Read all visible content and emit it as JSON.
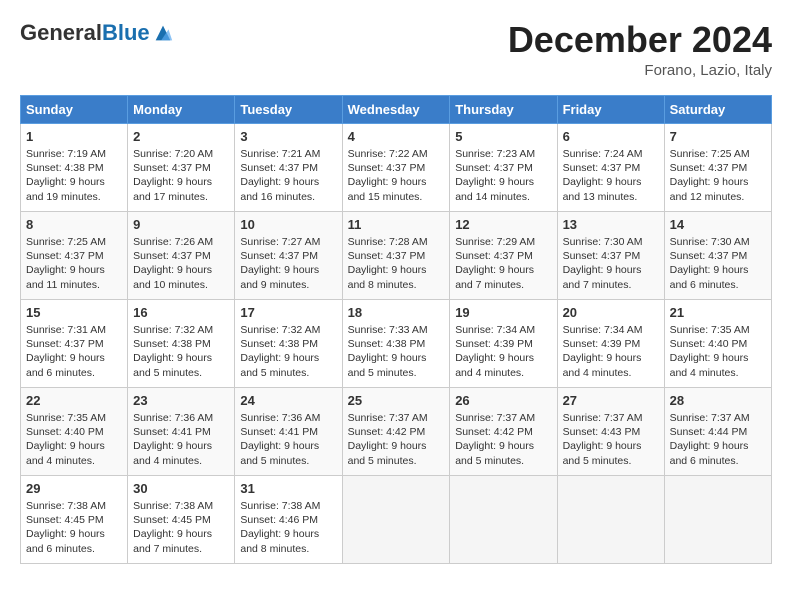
{
  "header": {
    "logo_general": "General",
    "logo_blue": "Blue",
    "month_title": "December 2024",
    "subtitle": "Forano, Lazio, Italy"
  },
  "weekdays": [
    "Sunday",
    "Monday",
    "Tuesday",
    "Wednesday",
    "Thursday",
    "Friday",
    "Saturday"
  ],
  "weeks": [
    [
      {
        "day": "1",
        "sunrise": "7:19 AM",
        "sunset": "4:38 PM",
        "daylight_h": "9",
        "daylight_m": "19"
      },
      {
        "day": "2",
        "sunrise": "7:20 AM",
        "sunset": "4:37 PM",
        "daylight_h": "9",
        "daylight_m": "17"
      },
      {
        "day": "3",
        "sunrise": "7:21 AM",
        "sunset": "4:37 PM",
        "daylight_h": "9",
        "daylight_m": "16"
      },
      {
        "day": "4",
        "sunrise": "7:22 AM",
        "sunset": "4:37 PM",
        "daylight_h": "9",
        "daylight_m": "15"
      },
      {
        "day": "5",
        "sunrise": "7:23 AM",
        "sunset": "4:37 PM",
        "daylight_h": "9",
        "daylight_m": "14"
      },
      {
        "day": "6",
        "sunrise": "7:24 AM",
        "sunset": "4:37 PM",
        "daylight_h": "9",
        "daylight_m": "13"
      },
      {
        "day": "7",
        "sunrise": "7:25 AM",
        "sunset": "4:37 PM",
        "daylight_h": "9",
        "daylight_m": "12"
      }
    ],
    [
      {
        "day": "8",
        "sunrise": "7:25 AM",
        "sunset": "4:37 PM",
        "daylight_h": "9",
        "daylight_m": "11"
      },
      {
        "day": "9",
        "sunrise": "7:26 AM",
        "sunset": "4:37 PM",
        "daylight_h": "9",
        "daylight_m": "10"
      },
      {
        "day": "10",
        "sunrise": "7:27 AM",
        "sunset": "4:37 PM",
        "daylight_h": "9",
        "daylight_m": "9"
      },
      {
        "day": "11",
        "sunrise": "7:28 AM",
        "sunset": "4:37 PM",
        "daylight_h": "9",
        "daylight_m": "8"
      },
      {
        "day": "12",
        "sunrise": "7:29 AM",
        "sunset": "4:37 PM",
        "daylight_h": "9",
        "daylight_m": "7"
      },
      {
        "day": "13",
        "sunrise": "7:30 AM",
        "sunset": "4:37 PM",
        "daylight_h": "9",
        "daylight_m": "7"
      },
      {
        "day": "14",
        "sunrise": "7:30 AM",
        "sunset": "4:37 PM",
        "daylight_h": "9",
        "daylight_m": "6"
      }
    ],
    [
      {
        "day": "15",
        "sunrise": "7:31 AM",
        "sunset": "4:37 PM",
        "daylight_h": "9",
        "daylight_m": "6"
      },
      {
        "day": "16",
        "sunrise": "7:32 AM",
        "sunset": "4:38 PM",
        "daylight_h": "9",
        "daylight_m": "5"
      },
      {
        "day": "17",
        "sunrise": "7:32 AM",
        "sunset": "4:38 PM",
        "daylight_h": "9",
        "daylight_m": "5"
      },
      {
        "day": "18",
        "sunrise": "7:33 AM",
        "sunset": "4:38 PM",
        "daylight_h": "9",
        "daylight_m": "5"
      },
      {
        "day": "19",
        "sunrise": "7:34 AM",
        "sunset": "4:39 PM",
        "daylight_h": "9",
        "daylight_m": "4"
      },
      {
        "day": "20",
        "sunrise": "7:34 AM",
        "sunset": "4:39 PM",
        "daylight_h": "9",
        "daylight_m": "4"
      },
      {
        "day": "21",
        "sunrise": "7:35 AM",
        "sunset": "4:40 PM",
        "daylight_h": "9",
        "daylight_m": "4"
      }
    ],
    [
      {
        "day": "22",
        "sunrise": "7:35 AM",
        "sunset": "4:40 PM",
        "daylight_h": "9",
        "daylight_m": "4"
      },
      {
        "day": "23",
        "sunrise": "7:36 AM",
        "sunset": "4:41 PM",
        "daylight_h": "9",
        "daylight_m": "4"
      },
      {
        "day": "24",
        "sunrise": "7:36 AM",
        "sunset": "4:41 PM",
        "daylight_h": "9",
        "daylight_m": "5"
      },
      {
        "day": "25",
        "sunrise": "7:37 AM",
        "sunset": "4:42 PM",
        "daylight_h": "9",
        "daylight_m": "5"
      },
      {
        "day": "26",
        "sunrise": "7:37 AM",
        "sunset": "4:42 PM",
        "daylight_h": "9",
        "daylight_m": "5"
      },
      {
        "day": "27",
        "sunrise": "7:37 AM",
        "sunset": "4:43 PM",
        "daylight_h": "9",
        "daylight_m": "5"
      },
      {
        "day": "28",
        "sunrise": "7:37 AM",
        "sunset": "4:44 PM",
        "daylight_h": "9",
        "daylight_m": "6"
      }
    ],
    [
      {
        "day": "29",
        "sunrise": "7:38 AM",
        "sunset": "4:45 PM",
        "daylight_h": "9",
        "daylight_m": "6"
      },
      {
        "day": "30",
        "sunrise": "7:38 AM",
        "sunset": "4:45 PM",
        "daylight_h": "9",
        "daylight_m": "7"
      },
      {
        "day": "31",
        "sunrise": "7:38 AM",
        "sunset": "4:46 PM",
        "daylight_h": "9",
        "daylight_m": "8"
      },
      null,
      null,
      null,
      null
    ]
  ]
}
